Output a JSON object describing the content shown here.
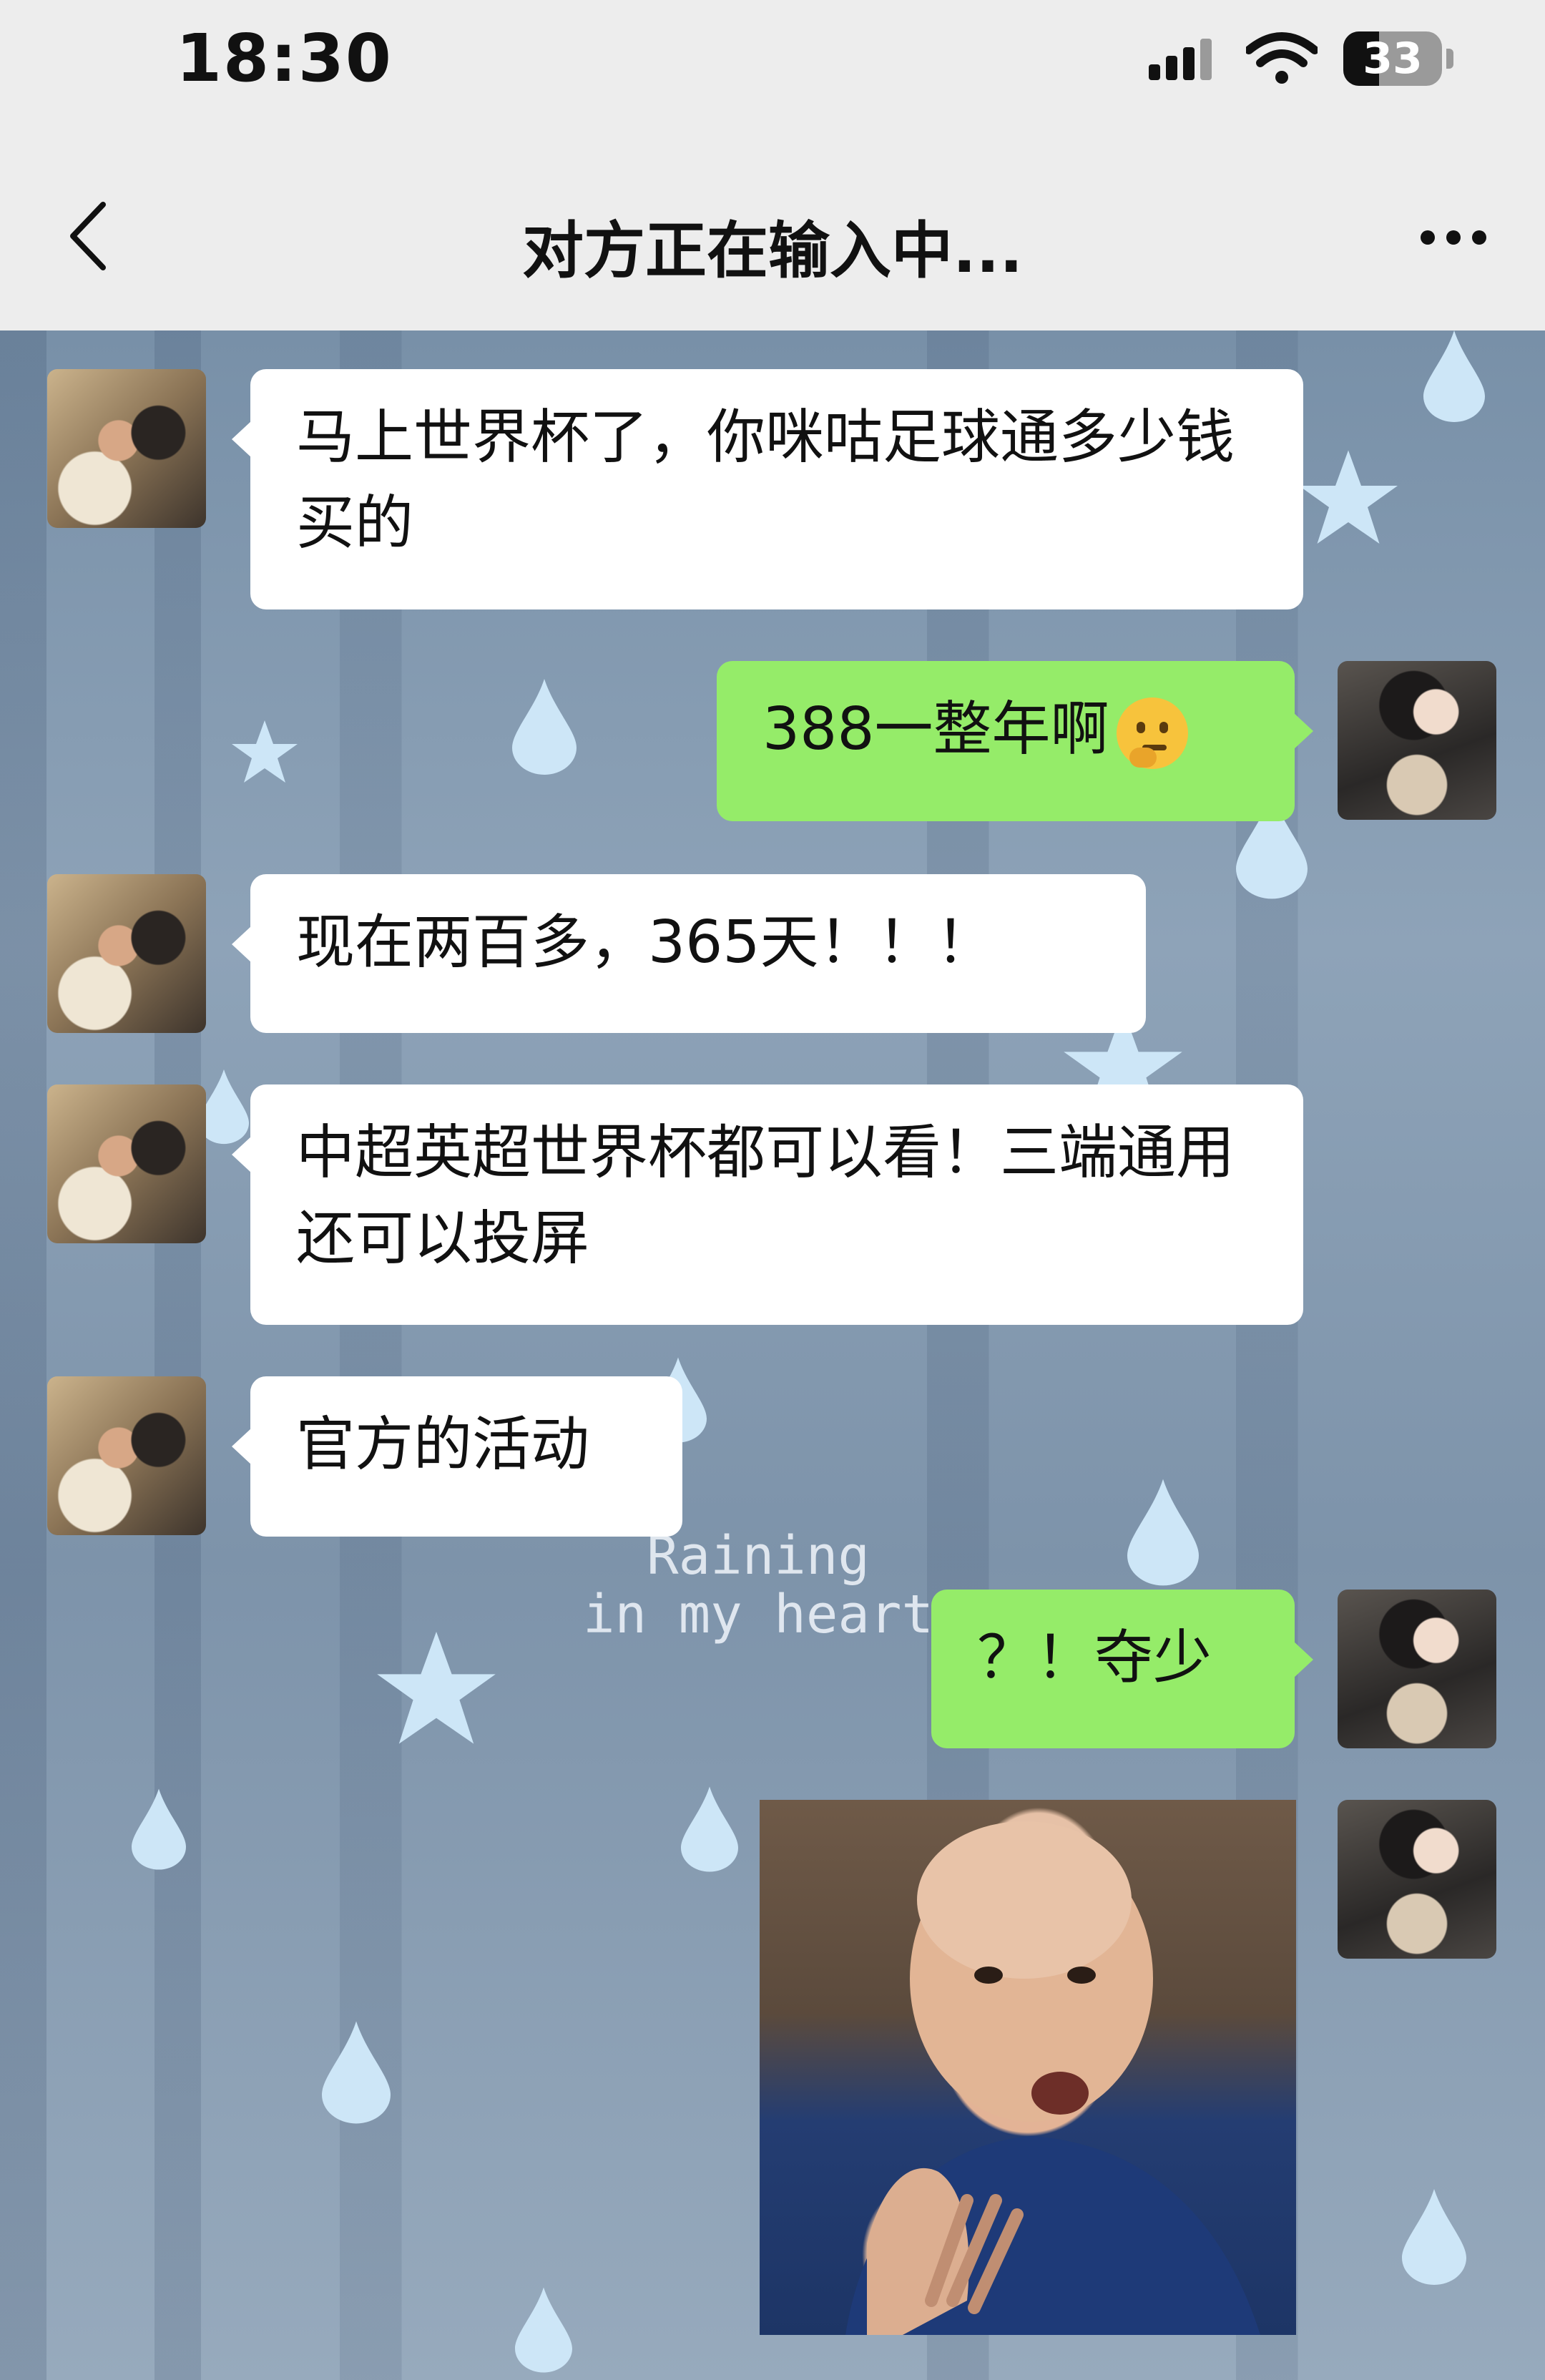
{
  "status_bar": {
    "time": "18:30",
    "battery": "33",
    "icons": [
      "cellular-signal-icon",
      "wifi-icon",
      "battery-icon"
    ]
  },
  "nav": {
    "title": "对方正在输入中...",
    "back_icon": "chevron-left-icon",
    "more_icon": "more-horizontal-icon"
  },
  "background_text": {
    "line1": "Raining",
    "line2": "in my heart"
  },
  "messages": [
    {
      "side": "in",
      "text": "马上世界杯了，你咪咕足球通多少钱买的"
    },
    {
      "side": "out",
      "text": "388一整年啊",
      "emoji": "thinking-face-emoji"
    },
    {
      "side": "in",
      "text": "现在两百多，365天！！！"
    },
    {
      "side": "in",
      "text": "中超英超世界杯都可以看！三端通用还可以投屏"
    },
    {
      "side": "in",
      "text": "官方的活动"
    },
    {
      "side": "out",
      "text": "？！夺少"
    },
    {
      "side": "out",
      "type": "image"
    }
  ],
  "colors": {
    "incoming_bubble": "#ffffff",
    "outgoing_bubble": "#95ec69",
    "header_bg": "#ededed"
  }
}
